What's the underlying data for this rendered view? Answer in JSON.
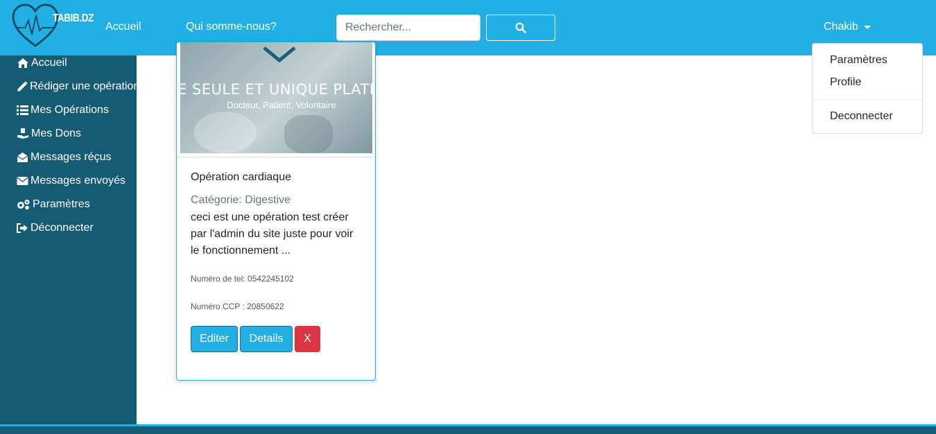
{
  "brand": {
    "logo_text": "TABIB.DZ"
  },
  "navbar": {
    "links": [
      "Accueil",
      "Qui somme-nous?"
    ],
    "search_placeholder": "Rechercher...",
    "search_icon": "search-icon",
    "user_name": "Chakib"
  },
  "dropdown": {
    "items": [
      "Paramètres",
      "Profile"
    ],
    "logout": "Deconnecter"
  },
  "sidebar": {
    "items": [
      {
        "label": "Accueil",
        "icon": "home-icon"
      },
      {
        "label": "Rédiger une opération",
        "icon": "pen-icon"
      },
      {
        "label": "Mes Opérations",
        "icon": "list-icon"
      },
      {
        "label": "Mes Dons",
        "icon": "donate-icon"
      },
      {
        "label": "Messages réçus",
        "icon": "envelope-open-icon"
      },
      {
        "label": "Messages envoyés",
        "icon": "envelope-icon"
      },
      {
        "label": "Paramètres",
        "icon": "gears-icon"
      },
      {
        "label": "Déconnecter",
        "icon": "sign-out-icon"
      }
    ]
  },
  "card": {
    "image_headline": "E SEULE ET UNIQUE PLATFO",
    "image_subline": "Docteur, Patient, Volontaire",
    "title": "Opération cardiaque",
    "category": "Catégorie: Digestive",
    "description": "ceci est une opération test créer par l'admin du site juste pour voir le fonctionnement ...",
    "phone": "Numéro de tel: 0542245102",
    "ccp": "Numéro CCP : 20850622",
    "buttons": {
      "edit": "Editer",
      "details": "Details",
      "delete": "X"
    }
  },
  "colors": {
    "primary": "#22b0e4",
    "sidebar": "#155b74",
    "danger": "#dc3545"
  }
}
